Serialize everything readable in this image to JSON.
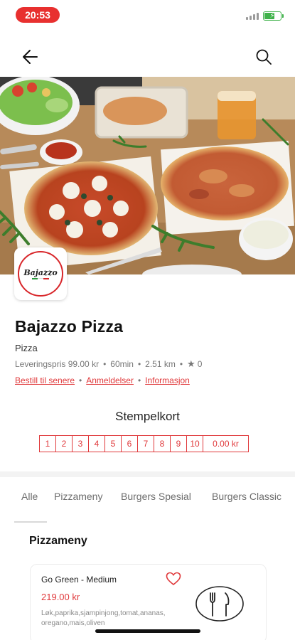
{
  "status_bar": {
    "time": "20:53"
  },
  "nav": {
    "back_icon": "arrow-left-icon",
    "search_icon": "search-icon"
  },
  "hero": {
    "image": "pizza-table-photo"
  },
  "restaurant": {
    "logo_text": "Bajazzo",
    "name": "Bajazzo Pizza",
    "category": "Pizza",
    "delivery_price": "Leveringspris 99.00 kr",
    "delivery_time": "60min",
    "distance": "2.51 km",
    "rating": "0",
    "links": {
      "order_later": "Bestill til senere",
      "reviews": "Anmeldelser",
      "info": "Informasjon"
    }
  },
  "stamp_card": {
    "title": "Stempelkort",
    "stamps": [
      "1",
      "2",
      "3",
      "4",
      "5",
      "6",
      "7",
      "8",
      "9",
      "10"
    ],
    "total": "0.00 kr"
  },
  "tabs": [
    "Alle",
    "Pizzameny",
    "Burgers Spesial",
    "Burgers Classic"
  ],
  "section": {
    "title": "Pizzameny"
  },
  "menu_item": {
    "name": "Go Green - Medium",
    "price": "219.00 kr",
    "description": "Løk,paprika,sjampinjong,tomat,ananas, oregano,mais,oliven"
  },
  "colors": {
    "accent": "#e0393b",
    "status_pill": "#e8302f",
    "battery": "#3fb24a"
  }
}
